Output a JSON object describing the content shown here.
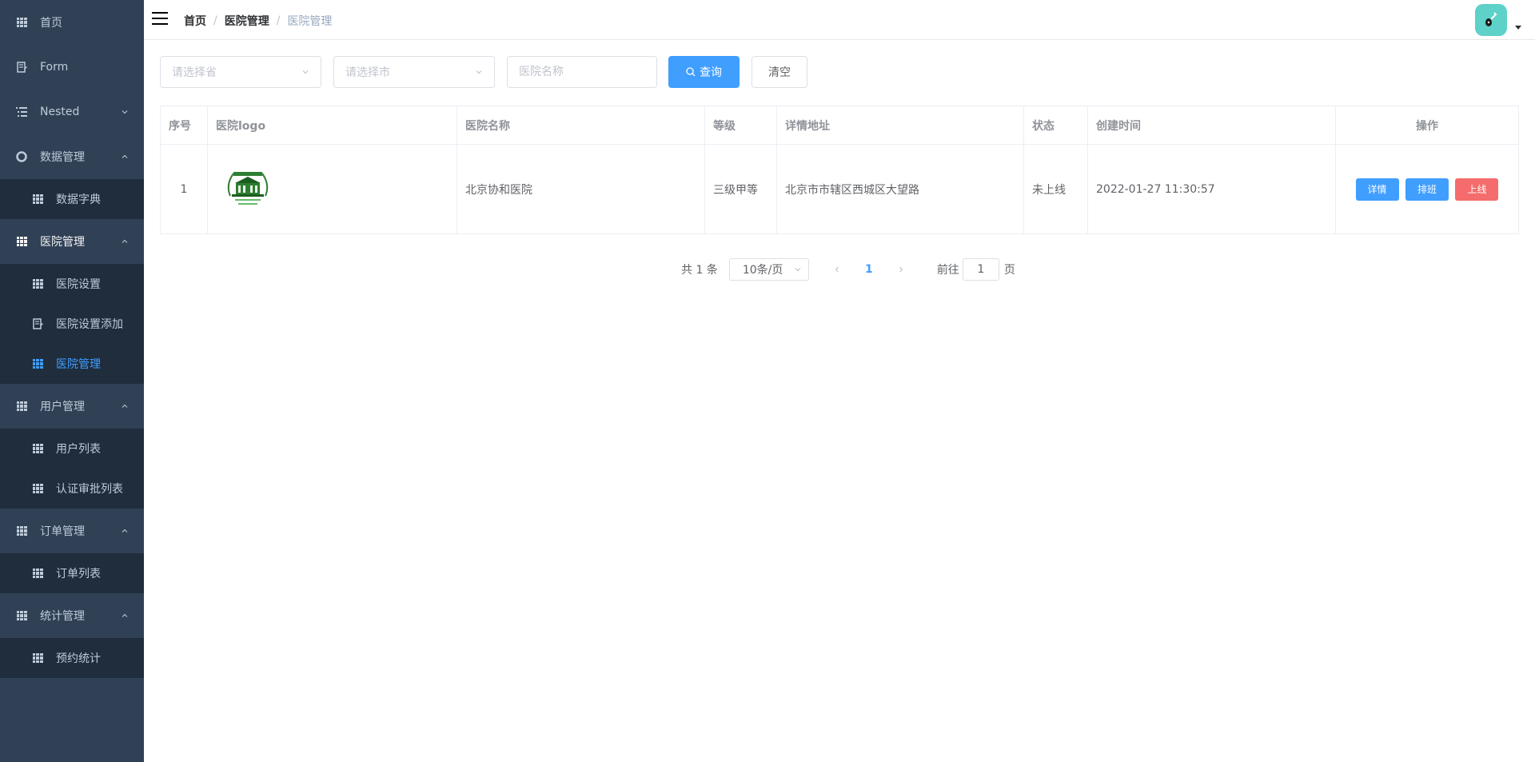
{
  "sidebar": {
    "home": "首页",
    "form": "Form",
    "nested": "Nested",
    "data_management": "数据管理",
    "data_dict": "数据字典",
    "hospital_management": "医院管理",
    "hospital_settings": "医院设置",
    "hospital_settings_add": "医院设置添加",
    "hospital_manage": "医院管理",
    "user_management": "用户管理",
    "user_list": "用户列表",
    "auth_list": "认证审批列表",
    "order_management": "订单管理",
    "order_list": "订单列表",
    "stats_management": "统计管理",
    "booking_stats": "预约统计"
  },
  "navbar": {
    "breadcrumbs": [
      "首页",
      "医院管理",
      "医院管理"
    ],
    "separator": "/"
  },
  "filters": {
    "province_placeholder": "请选择省",
    "city_placeholder": "请选择市",
    "name_placeholder": "医院名称",
    "search_label": "查询",
    "clear_label": "清空"
  },
  "table": {
    "headers": {
      "index": "序号",
      "logo": "医院logo",
      "name": "医院名称",
      "level": "等级",
      "address": "详情地址",
      "status": "状态",
      "created": "创建时间",
      "actions": "操作"
    },
    "rows": [
      {
        "index": "1",
        "name": "北京协和医院",
        "level": "三级甲等",
        "address": "北京市市辖区西城区大望路",
        "status": "未上线",
        "created": "2022-01-27 11:30:57",
        "detail_label": "详情",
        "schedule_label": "排班",
        "online_label": "上线"
      }
    ]
  },
  "pagination": {
    "total": "共 1 条",
    "page_size": "10条/页",
    "current_page": "1",
    "goto_prefix": "前往",
    "goto_value": "1",
    "goto_suffix": "页"
  },
  "colors": {
    "sidebar_bg": "#304156",
    "submenu_bg": "#1f2d3d",
    "primary": "#409eff",
    "danger": "#f56c6c",
    "avatar_bg": "#5ed1c8"
  }
}
